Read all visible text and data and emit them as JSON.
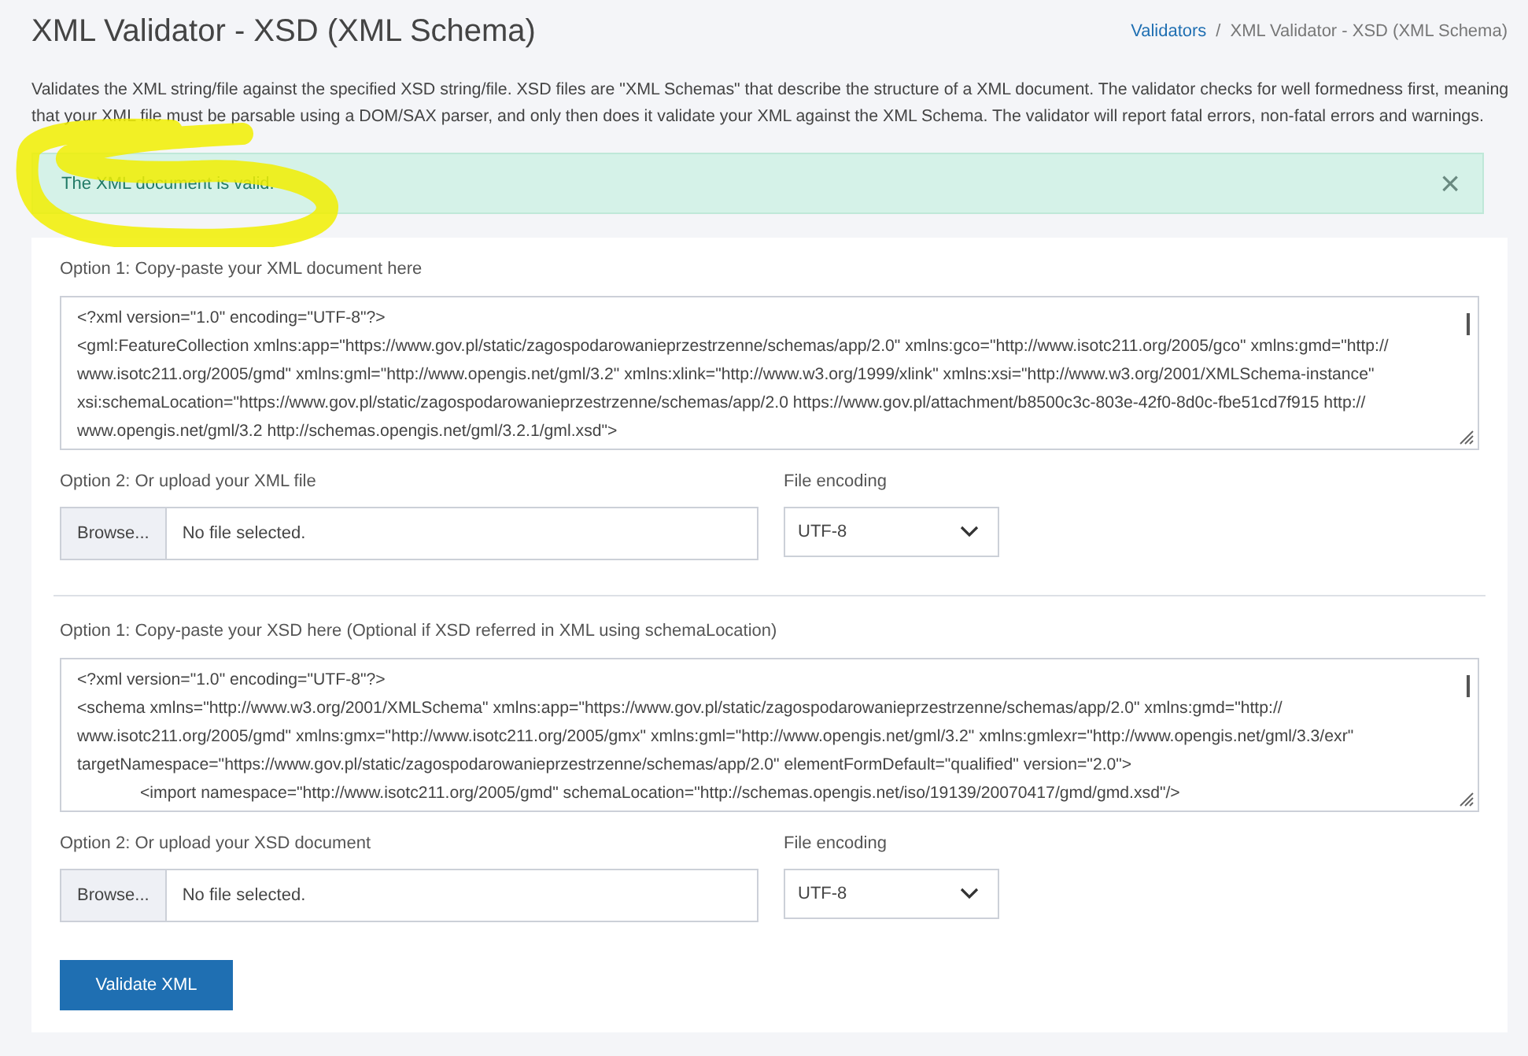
{
  "header": {
    "title": "XML Validator - XSD (XML Schema)",
    "separator": "/",
    "breadcrumb": [
      {
        "label": "Validators",
        "link": true
      },
      {
        "label": "XML Validator - XSD (XML Schema)",
        "link": false
      }
    ]
  },
  "description": "Validates the XML string/file against the specified XSD string/file. XSD files are \"XML Schemas\" that describe the structure of a XML document. The validator checks for well formedness first, meaning that your XML file must be parsable using a DOM/SAX parser, and only then does it validate your XML against the XML Schema. The validator will report fatal errors, non-fatal errors and warnings.",
  "alert": {
    "message": "The XML document is valid.",
    "close": "×",
    "highlighted": true
  },
  "sections": [
    {
      "paste_label": "Option 1: Copy-paste your XML document here",
      "lines": [
        {
          "text": "<?xml version=\"1.0\" encoding=\"UTF-8\"?>",
          "indent": false
        },
        {
          "text": "<gml:FeatureCollection xmlns:app=\"https://www.gov.pl/static/zagospodarowanieprzestrzenne/schemas/app/2.0\" xmlns:gco=\"http://www.isotc211.org/2005/gco\" xmlns:gmd=\"http://",
          "indent": false
        },
        {
          "text": "www.isotc211.org/2005/gmd\" xmlns:gml=\"http://www.opengis.net/gml/3.2\" xmlns:xlink=\"http://www.w3.org/1999/xlink\" xmlns:xsi=\"http://www.w3.org/2001/XMLSchema-instance\"",
          "indent": false
        },
        {
          "text": "xsi:schemaLocation=\"https://www.gov.pl/static/zagospodarowanieprzestrzenne/schemas/app/2.0 https://www.gov.pl/attachment/b8500c3c-803e-42f0-8d0c-fbe51cd7f915 http://",
          "indent": false
        },
        {
          "text": "www.opengis.net/gml/3.2 http://schemas.opengis.net/gml/3.2.1/gml.xsd\">",
          "indent": false
        }
      ],
      "upload_label": "Option 2: Or upload your XML file",
      "browse": "Browse...",
      "file": "No file selected.",
      "encoding_label": "File encoding",
      "encoding": "UTF-8"
    },
    {
      "paste_label": "Option 1: Copy-paste your XSD here (Optional if XSD referred in XML using schemaLocation)",
      "lines": [
        {
          "text": "<?xml version=\"1.0\" encoding=\"UTF-8\"?>",
          "indent": false
        },
        {
          "text": "<schema xmlns=\"http://www.w3.org/2001/XMLSchema\" xmlns:app=\"https://www.gov.pl/static/zagospodarowanieprzestrzenne/schemas/app/2.0\" xmlns:gmd=\"http://",
          "indent": false
        },
        {
          "text": "www.isotc211.org/2005/gmd\" xmlns:gmx=\"http://www.isotc211.org/2005/gmx\" xmlns:gml=\"http://www.opengis.net/gml/3.2\" xmlns:gmlexr=\"http://www.opengis.net/gml/3.3/exr\"",
          "indent": false
        },
        {
          "text": "targetNamespace=\"https://www.gov.pl/static/zagospodarowanieprzestrzenne/schemas/app/2.0\" elementFormDefault=\"qualified\" version=\"2.0\">",
          "indent": false
        },
        {
          "text": "<import namespace=\"http://www.isotc211.org/2005/gmd\" schemaLocation=\"http://schemas.opengis.net/iso/19139/20070417/gmd/gmd.xsd\"/>",
          "indent": true
        }
      ],
      "upload_label": "Option 2: Or upload your XSD document",
      "browse": "Browse...",
      "file": "No file selected.",
      "encoding_label": "File encoding",
      "encoding": "UTF-8"
    }
  ],
  "submit": "Validate XML"
}
